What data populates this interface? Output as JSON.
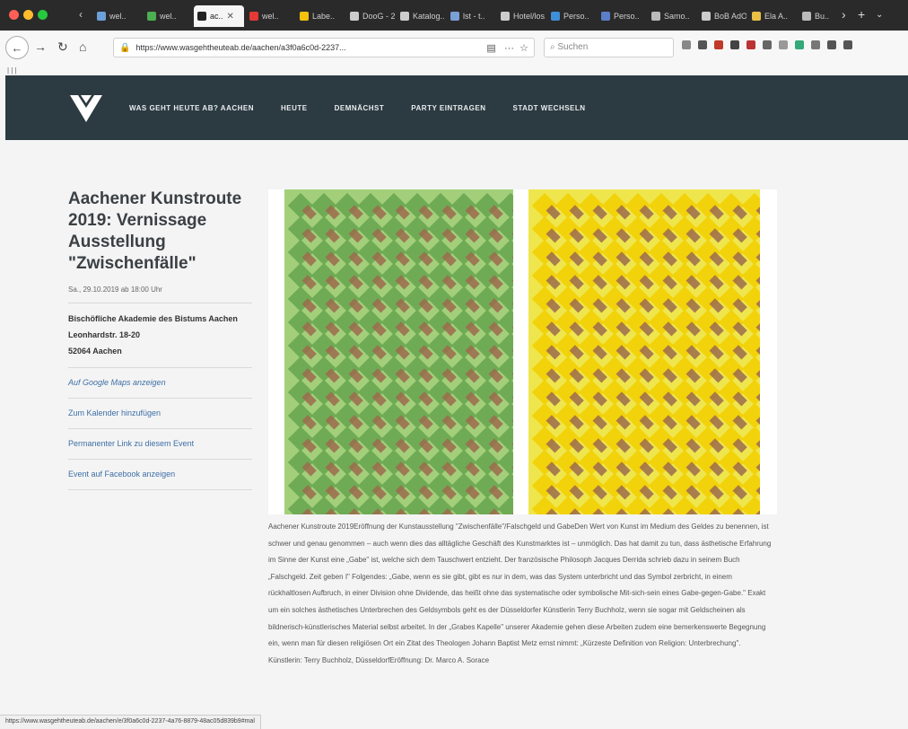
{
  "browser": {
    "tabs": [
      {
        "label": "wel..",
        "color": "#6ba0d8",
        "active": false
      },
      {
        "label": "wel..",
        "color": "#4caf50",
        "active": false
      },
      {
        "label": "ac..",
        "color": "#222222",
        "active": true
      },
      {
        "label": "wel..",
        "color": "#e53935",
        "active": false
      },
      {
        "label": "Labe..",
        "color": "#f4c20d",
        "active": false
      },
      {
        "label": "DooG - 2..",
        "color": "#cccccc",
        "active": false
      },
      {
        "label": "Katalog..",
        "color": "#cccccc",
        "active": false
      },
      {
        "label": "lst - t..",
        "color": "#7aa0d8",
        "active": false
      },
      {
        "label": "Hotel/los..",
        "color": "#cccccc",
        "active": false
      },
      {
        "label": "Perso..",
        "color": "#3f8fd8",
        "active": false
      },
      {
        "label": "Perso..",
        "color": "#5a7ec8",
        "active": false
      },
      {
        "label": "Samo..",
        "color": "#bbbbbb",
        "active": false
      },
      {
        "label": "BoB AdO..",
        "color": "#cccccc",
        "active": false
      },
      {
        "label": "Ela A..",
        "color": "#e9c046",
        "active": false
      },
      {
        "label": "Bu..",
        "color": "#bbbbbb",
        "active": false
      }
    ],
    "url": "https://www.wasgehtheuteab.de/aachen/a3f0a6c0d-2237...",
    "search_placeholder": "Suchen",
    "status_url": "https://www.wasgehtheuteab.de/aachen/e/3f0a6c0d-2237-4a76-8879-48ac05d839b9#mal"
  },
  "site": {
    "nav": [
      "WAS GEHT HEUTE AB? AACHEN",
      "HEUTE",
      "DEMNÄCHST",
      "PARTY EINTRAGEN",
      "STADT WECHSELN"
    ]
  },
  "event": {
    "title": "Aachener Kunstroute 2019: Vernissage Ausstellung \"Zwischenfälle\"",
    "date": "Sa., 29.10.2019 ab 18:00 Uhr",
    "venue_name": "Bischöfliche Akademie des Bistums Aachen",
    "venue_street": "Leonhardstr. 18-20",
    "venue_city": "52064  Aachen",
    "link_maps": "Auf Google Maps anzeigen",
    "link_calendar": "Zum Kalender hinzufügen",
    "link_permalink": "Permanenter Link zu diesem Event",
    "link_facebook": "Event auf Facebook anzeigen",
    "description": "Aachener Kunstroute 2019Eröffnung der Kunstausstellung \"Zwischenfälle\"/Falschgeld und GabeDen Wert von Kunst im Medium des Geldes zu benennen, ist schwer und genau genommen – auch wenn dies das alltägliche Geschäft des Kunstmarktes ist – unmöglich. Das hat damit zu tun, dass ästhetische Erfahrung im Sinne der Kunst eine „Gabe\" ist, welche sich dem Tauschwert entzieht. Der französische Philosoph Jacques Derrida schrieb dazu in seinem Buch „Falschgeld. Zeit geben I\" Folgendes: „Gabe, wenn es sie gibt, gibt es nur in dem, was das System unterbricht und das Symbol zerbricht, in einem rückhaltlosen Aufbruch, in einer Division ohne Dividende, das heißt ohne das systematische oder symbolische Mit-sich-sein eines Gabe-gegen-Gabe.\" Exakt um ein solches ästhetisches Unterbrechen des Geldsymbols geht es der Düsseldorfer Künstlerin Terry Buchholz, wenn sie sogar mit Geldscheinen als bildnerisch-künstlerisches Material selbst arbeitet. In der „Grabes Kapelle\" unserer Akademie gehen diese Arbeiten zudem eine bemerkenswerte Begegnung ein, wenn man für diesen religiösen Ort ein Zitat des Theologen Johann Baptist Metz ernst nimmt: „Kürzeste Definition von Religion: Unterbrechung\". Künstlerin: Terry Buchholz, DüsseldorfEröffnung: Dr. Marco A. Sorace"
  },
  "colors": {
    "header_bg": "#2c3a41",
    "title_text": "#3b4044",
    "link": "#3d6fa6",
    "art_green": "#a3cf7b",
    "art_green_dark": "#6fab55",
    "art_yellow": "#efe64e",
    "art_yellow_dark": "#f2d20a",
    "banknote": "#9c6b4e"
  },
  "icons": [
    "back-icon",
    "forward-icon",
    "reload-icon",
    "home-icon",
    "lock-icon",
    "reader-icon",
    "bookmark-star-icon",
    "search-icon",
    "logo-icon"
  ]
}
